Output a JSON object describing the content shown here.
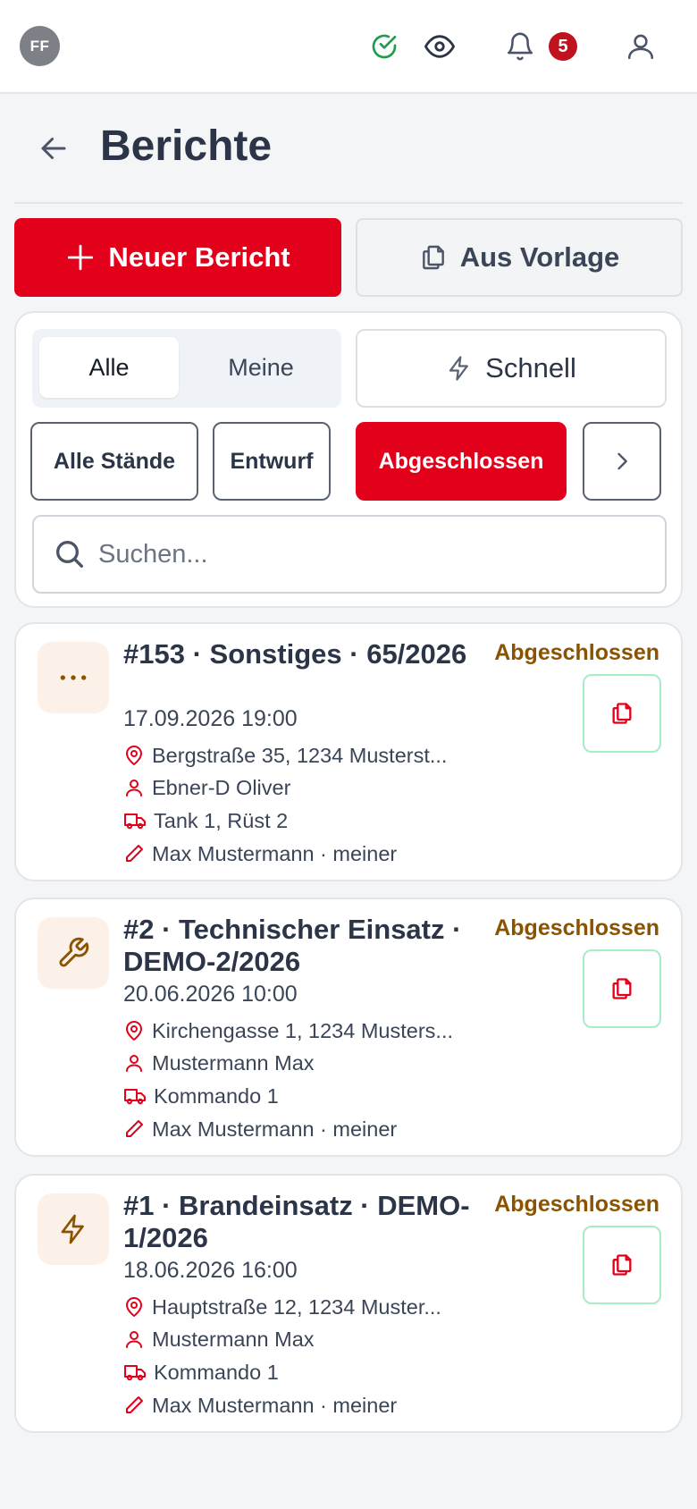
{
  "header": {
    "avatar_initials": "FF",
    "notification_count": "5",
    "icons": [
      "check-circle-icon",
      "eye-icon",
      "bell-icon",
      "user-icon"
    ]
  },
  "page": {
    "title": "Berichte"
  },
  "actions": {
    "new_report": "Neuer Bericht",
    "from_template": "Aus Vorlage"
  },
  "filters": {
    "scope_all": "Alle",
    "scope_mine": "Meine",
    "quick": "Schnell",
    "status_all": "Alle Stände",
    "status_draft": "Entwurf",
    "status_closed": "Abgeschlossen",
    "search_placeholder": "Suchen..."
  },
  "colors": {
    "accent": "#e2001a",
    "status": "#8b5300",
    "icon_bg": "#fcf1e8",
    "copy_border": "#a6ecc8"
  },
  "reports": [
    {
      "icon": "dots-icon",
      "title": "#153 · Sonstiges · 65/2026",
      "date": "17.09.2026 19:00",
      "address": "Bergstraße 35, 1234 Musterst...",
      "person": "Ebner-D Oliver",
      "vehicles": "Tank 1, Rüst 2",
      "author": "Max Mustermann · meiner",
      "status": "Abgeschlossen"
    },
    {
      "icon": "wrench-icon",
      "title": "#2 · Technischer Einsatz · DEMO-2/2026",
      "date": "20.06.2026 10:00",
      "address": "Kirchengasse 1, 1234 Musters...",
      "person": "Mustermann Max",
      "vehicles": "Kommando 1",
      "author": "Max Mustermann · meiner",
      "status": "Abgeschlossen"
    },
    {
      "icon": "lightning-icon",
      "title": "#1 · Brandeinsatz · DEMO-1/2026",
      "date": "18.06.2026 16:00",
      "address": "Hauptstraße 12, 1234 Muster...",
      "person": "Mustermann Max",
      "vehicles": "Kommando 1",
      "author": "Max Mustermann · meiner",
      "status": "Abgeschlossen"
    }
  ]
}
